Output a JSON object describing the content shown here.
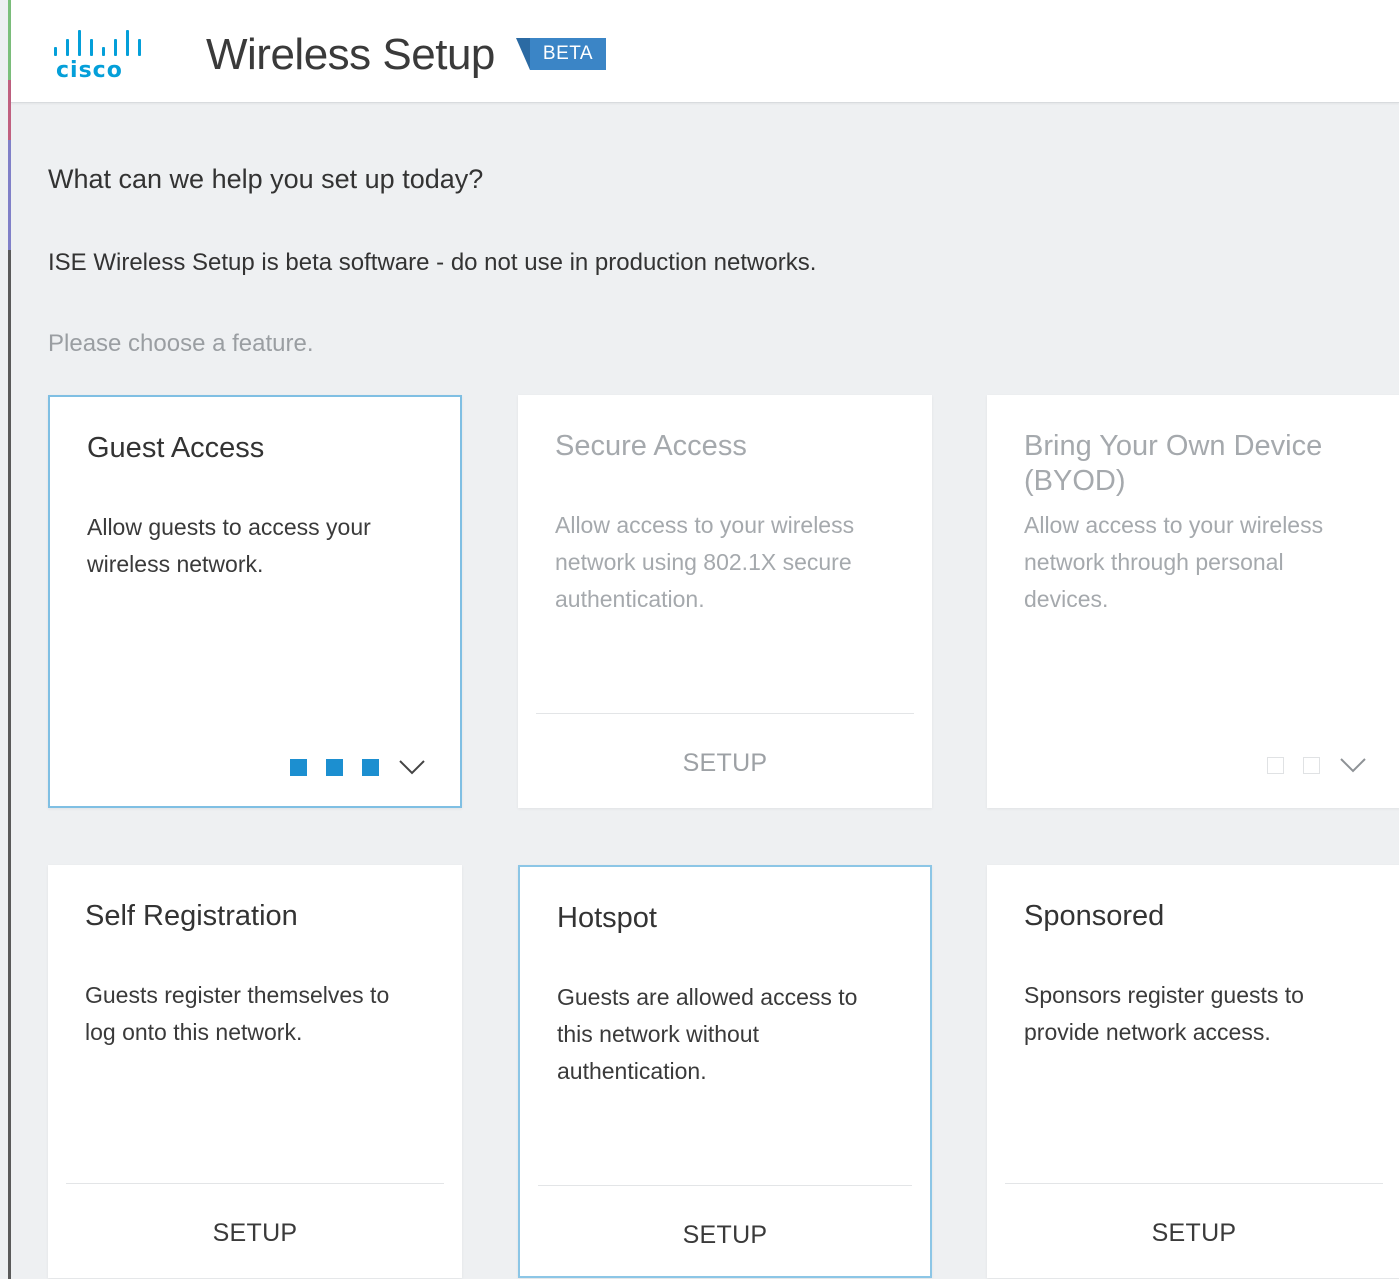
{
  "header": {
    "brand": "cisco",
    "title": "Wireless Setup",
    "badge": "BETA"
  },
  "main": {
    "question": "What can we help you set up today?",
    "warning": "ISE Wireless Setup is beta software - do not use in production networks.",
    "hint": "Please choose a feature."
  },
  "cards": [
    {
      "title": "Guest Access",
      "description": "Allow guests to access your wireless network.",
      "state": "selected",
      "progress": {
        "completed": 3,
        "total": 3
      }
    },
    {
      "title": "Secure Access",
      "description": "Allow access to your wireless network using 802.1X secure authentication.",
      "action": "SETUP",
      "state": "disabled"
    },
    {
      "title": "Bring Your Own Device (BYOD)",
      "description": "Allow access to your wireless network through personal devices.",
      "state": "disabled",
      "progress": {
        "completed": 0,
        "total": 2
      }
    },
    {
      "title": "Self Registration",
      "description": "Guests register themselves to log onto this network.",
      "action": "SETUP"
    },
    {
      "title": "Hotspot",
      "description": "Guests are allowed access to this network without authentication.",
      "action": "SETUP",
      "state": "highlighted"
    },
    {
      "title": "Sponsored",
      "description": "Sponsors register guests to provide network access.",
      "action": "SETUP"
    }
  ],
  "colors": {
    "brand": "#049fd9",
    "badge": "#3b85c6",
    "step_active": "#1c8fd0",
    "selected_border": "#7fbfe3",
    "page_bg": "#eef0f2"
  },
  "icons": {
    "expand": "chevron-down-icon",
    "step_complete": "filled-square-icon",
    "step_incomplete": "empty-square-icon"
  }
}
